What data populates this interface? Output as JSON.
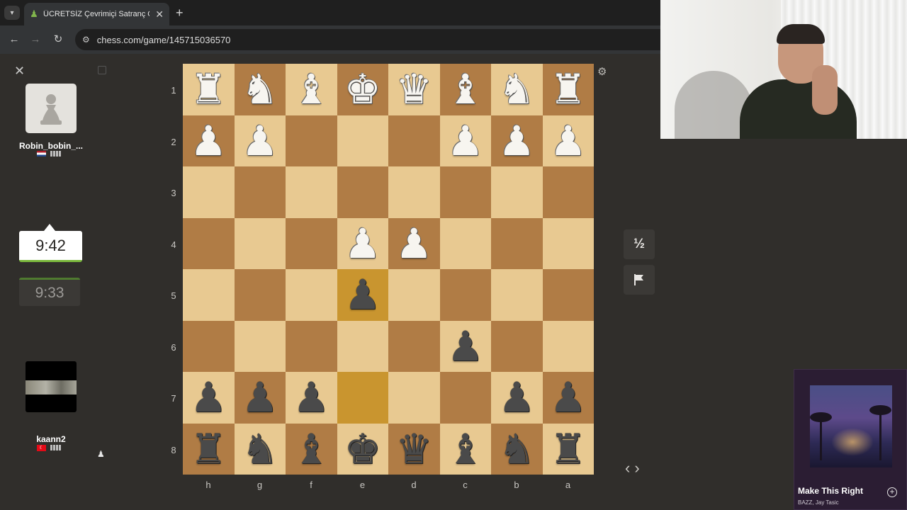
{
  "browser": {
    "tab_title": "ÜCRETSİZ Çevrimiçi Satranç Oy",
    "tab_favicon": "pawn-icon",
    "url": "chess.com/game/145715036570",
    "new_tab_symbol": "+",
    "close_symbol": "✕"
  },
  "players": {
    "top": {
      "username": "Robin_bobin_...",
      "clock": "9:42",
      "flag": "NL",
      "avatar": "pawn-avatar"
    },
    "bottom": {
      "username": "kaann2",
      "clock": "9:33",
      "flag": "TR",
      "flag_symbol": "☾"
    }
  },
  "board": {
    "ranks": [
      "1",
      "2",
      "3",
      "4",
      "5",
      "6",
      "7",
      "8"
    ],
    "files": [
      "h",
      "g",
      "f",
      "e",
      "d",
      "c",
      "b",
      "a"
    ],
    "highlight_squares": [
      "e5",
      "e7"
    ],
    "rows": [
      [
        "wR",
        "wN",
        "wB",
        "wK",
        "wQ",
        "wB",
        "wN",
        "wR"
      ],
      [
        "wP",
        "wP",
        "",
        "",
        "",
        "wP",
        "wP",
        "wP"
      ],
      [
        "",
        "",
        "",
        "",
        "",
        "",
        "",
        ""
      ],
      [
        "",
        "",
        "",
        "wP",
        "wP",
        "",
        "",
        ""
      ],
      [
        "",
        "",
        "",
        "bP",
        "",
        "",
        "",
        ""
      ],
      [
        "",
        "",
        "",
        "",
        "",
        "bP",
        "",
        ""
      ],
      [
        "bP",
        "bP",
        "bP",
        "",
        "",
        "",
        "bP",
        "bP"
      ],
      [
        "bR",
        "bN",
        "bB",
        "bK",
        "bQ",
        "bB",
        "bN",
        "bR"
      ]
    ]
  },
  "controls": {
    "draw_label": "½",
    "resign_icon": "flag-icon",
    "prev_move": "‹",
    "next_move": "›",
    "settings_icon": "gear-icon"
  },
  "music": {
    "title": "Make This Right",
    "artist": "BAZZ, Jay Tasic",
    "add_icon": "plus-circle-icon"
  },
  "colors": {
    "board_light": "#e8c991",
    "board_dark": "#b07c45",
    "background": "#302e2b",
    "clock_active_bar": "#7ab73c"
  }
}
